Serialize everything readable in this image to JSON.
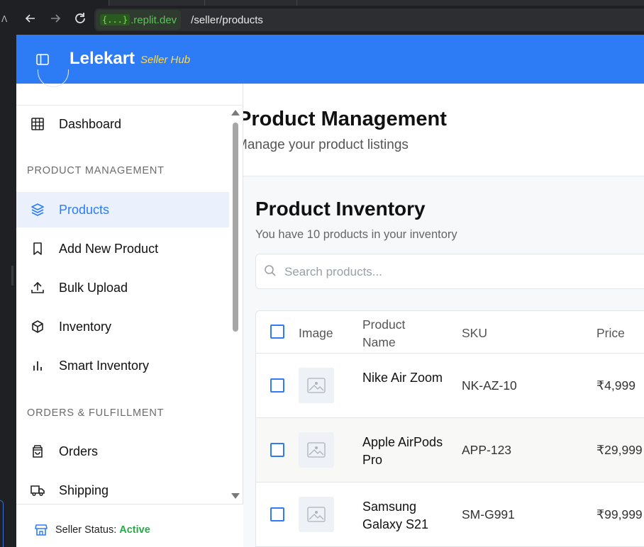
{
  "browser": {
    "url_chip_braces": "{...}",
    "url_host": ".replit.dev",
    "url_path": "/seller/products"
  },
  "header": {
    "brand": "Lelekart",
    "brand_sub": "Seller Hub"
  },
  "sidebar": {
    "items_top": [
      {
        "label": "Dashboard",
        "icon": "grid-icon"
      }
    ],
    "section_product": "PRODUCT MANAGEMENT",
    "items_product": [
      {
        "label": "Products",
        "icon": "layers-icon",
        "active": true
      },
      {
        "label": "Add New Product",
        "icon": "bookmark-icon"
      },
      {
        "label": "Bulk Upload",
        "icon": "upload-icon"
      },
      {
        "label": "Inventory",
        "icon": "box-icon"
      },
      {
        "label": "Smart Inventory",
        "icon": "bar-chart-icon"
      }
    ],
    "section_orders": "ORDERS & FULFILLMENT",
    "items_orders": [
      {
        "label": "Orders",
        "icon": "shopping-bag-icon"
      },
      {
        "label": "Shipping",
        "icon": "truck-icon"
      }
    ],
    "footer": {
      "label": "Seller Status: ",
      "status": "Active",
      "icon": "store-icon"
    }
  },
  "main": {
    "title": "Product Management",
    "subtitle": "Manage your product listings",
    "card": {
      "title": "Product Inventory",
      "subtitle": "You have 10 products in your inventory",
      "search_placeholder": "Search products..."
    },
    "table": {
      "columns": [
        "Image",
        "Product Name",
        "SKU",
        "Price"
      ],
      "rows": [
        {
          "name": "Nike Air Zoom",
          "sku": "NK-AZ-10",
          "price": "₹4,999"
        },
        {
          "name": "Apple AirPods Pro",
          "sku": "APP-123",
          "price": "₹29,999"
        },
        {
          "name": "Samsung Galaxy S21",
          "sku": "SM-G991",
          "price": "₹99,999"
        }
      ]
    }
  },
  "colors": {
    "accent": "#2d7cf6",
    "active_bg": "#eaf1fc",
    "status_green": "#2aa84a",
    "brand_sub": "#ffd84d"
  }
}
